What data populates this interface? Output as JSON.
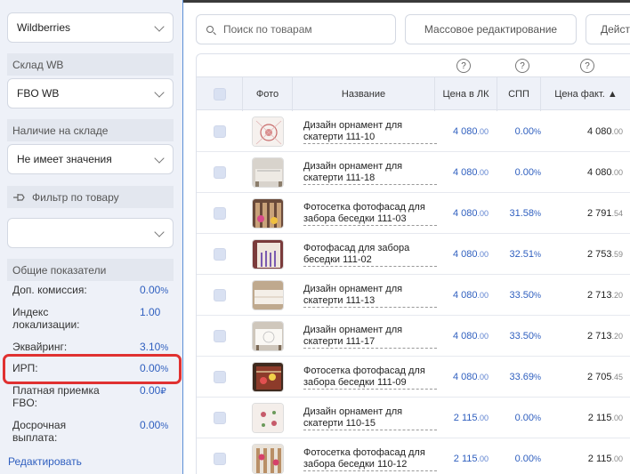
{
  "sidebar": {
    "marketplace_select": "Wildberries",
    "warehouse_label": "Склад WB",
    "warehouse_select": "FBO WB",
    "stock_label": "Наличие на складе",
    "stock_select": "Не имеет значения",
    "product_filter_label": "Фильтр по товару",
    "product_filter_value": "",
    "general_label": "Общие показатели",
    "stats": [
      {
        "label": "Доп. комиссия:",
        "value": "0.00",
        "unit": "%"
      },
      {
        "label": "Индекс\nлокализации:",
        "value": "1.00",
        "unit": ""
      },
      {
        "label": "Эквайринг:",
        "value": "3.10",
        "unit": "%"
      },
      {
        "label": "ИРП:",
        "value": "0.00",
        "unit": "%"
      },
      {
        "label": "Платная приемка\nFBO:",
        "value": "0.00",
        "unit": "₽"
      },
      {
        "label": "Досрочная\nвыплата:",
        "value": "0.00",
        "unit": "%"
      }
    ],
    "edit_link": "Редактировать"
  },
  "toolbar": {
    "search_placeholder": "Поиск по товарам",
    "bulk_edit": "Массовое редактирование",
    "actions": "Действия"
  },
  "table": {
    "help_icon": "?",
    "columns": {
      "photo": "Фото",
      "name": "Название",
      "price": "Цена в ЛК",
      "spp": "СПП",
      "fact": "Цена факт. ▲"
    },
    "rows": [
      {
        "name": "Дизайн орнамент для скатерти 111-10",
        "price": "4 080",
        "price_dec": ".00",
        "spp": "0.00",
        "fact": "4 080",
        "fact_dec": ".00",
        "thumb": "embroidery-white"
      },
      {
        "name": "Дизайн орнамент для скатерти 111-18",
        "price": "4 080",
        "price_dec": ".00",
        "spp": "0.00",
        "fact": "4 080",
        "fact_dec": ".00",
        "thumb": "table-grey"
      },
      {
        "name": "Фотосетка фотофасад для забора беседки 111-03",
        "price": "4 080",
        "price_dec": ".00",
        "spp": "31.58",
        "fact": "2 791",
        "fact_dec": ".54",
        "thumb": "fence-flowers"
      },
      {
        "name": "Фотофасад для забора беседки 111-02",
        "price": "4 080",
        "price_dec": ".00",
        "spp": "32.51",
        "fact": "2 753",
        "fact_dec": ".59",
        "thumb": "fence-lavender"
      },
      {
        "name": "Дизайн орнамент для скатерти 111-13",
        "price": "4 080",
        "price_dec": ".00",
        "spp": "33.50",
        "fact": "2 713",
        "fact_dec": ".20",
        "thumb": "table-beige"
      },
      {
        "name": "Дизайн орнамент для скатерти 111-17",
        "price": "4 080",
        "price_dec": ".00",
        "spp": "33.50",
        "fact": "2 713",
        "fact_dec": ".20",
        "thumb": "table-lace"
      },
      {
        "name": "Фотосетка фотофасад для забора беседки 111-09",
        "price": "4 080",
        "price_dec": ".00",
        "spp": "33.69",
        "fact": "2 705",
        "fact_dec": ".45",
        "thumb": "fence-red"
      },
      {
        "name": "Дизайн орнамент для скатерти 110-15",
        "price": "2 115",
        "price_dec": ".00",
        "spp": "0.00",
        "fact": "2 115",
        "fact_dec": ".00",
        "thumb": "embroidery-floral"
      },
      {
        "name": "Фотосетка фотофасад для забора беседки 110-12",
        "price": "2 115",
        "price_dec": ".00",
        "spp": "0.00",
        "fact": "2 115",
        "fact_dec": ".00",
        "thumb": "fence-roses"
      }
    ]
  },
  "colors": {
    "accent": "#2f5fbf",
    "highlight": "#e03131",
    "sidebar_bg": "#eef1f8"
  }
}
